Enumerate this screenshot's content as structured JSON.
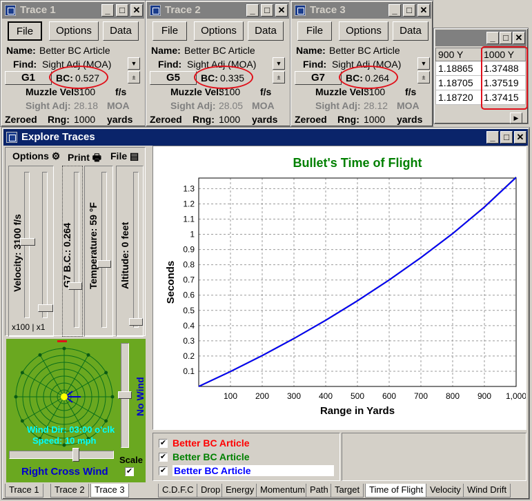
{
  "traces": [
    {
      "title": "Trace 1",
      "menu": [
        "File",
        "Options",
        "Data"
      ],
      "name_label": "Name:",
      "name": "Better BC Article",
      "find_label": "Find:",
      "find_value": "Sight Adj (MOA)",
      "model": "G1",
      "bc_label": "BC:",
      "bc": "0.527",
      "mv_label": "Muzzle Vel:",
      "mv": "3100",
      "mv_unit": "f/s",
      "sa_label": "Sight Adj:",
      "sa": "28.18",
      "sa_unit": "MOA",
      "zero_label": "Zeroed",
      "rng_label": "Rng:",
      "rng": "1000",
      "rng_unit": "yards"
    },
    {
      "title": "Trace 2",
      "menu": [
        "File",
        "Options",
        "Data"
      ],
      "name_label": "Name:",
      "name": "Better BC Article",
      "find_label": "Find:",
      "find_value": "Sight Adj (MOA)",
      "model": "G5",
      "bc_label": "BC:",
      "bc": "0.335",
      "mv_label": "Muzzle Vel:",
      "mv": "3100",
      "mv_unit": "f/s",
      "sa_label": "Sight Adj:",
      "sa": "28.05",
      "sa_unit": "MOA",
      "zero_label": "Zeroed",
      "rng_label": "Rng:",
      "rng": "1000",
      "rng_unit": "yards"
    },
    {
      "title": "Trace 3",
      "menu": [
        "File",
        "Options",
        "Data"
      ],
      "name_label": "Name:",
      "name": "Better BC Article",
      "find_label": "Find:",
      "find_value": "Sight Adj (MOA)",
      "model": "G7",
      "bc_label": "BC:",
      "bc": "0.264",
      "mv_label": "Muzzle Vel:",
      "mv": "3100",
      "mv_unit": "f/s",
      "sa_label": "Sight Adj:",
      "sa": "28.12",
      "sa_unit": "MOA",
      "zero_label": "Zeroed",
      "rng_label": "Rng:",
      "rng": "1000",
      "rng_unit": "yards"
    }
  ],
  "table": {
    "headers": [
      "900 Y",
      "1000 Y"
    ],
    "rows": [
      [
        "1.18865",
        "1.37488"
      ],
      [
        "1.18705",
        "1.37519"
      ],
      [
        "1.18720",
        "1.37415"
      ]
    ]
  },
  "explore": {
    "title": "Explore Traces",
    "options_label": "Options",
    "print_label": "Print",
    "file_label": "File",
    "velocity_label": "Velocity: 3100 f/s",
    "bc_slider_label": "G7 B.C.: 0.264",
    "temp_label": "Temperature: 59 °F",
    "alt_label": "Altitude: 0 feet",
    "scale_text": "x100 | x1",
    "wind_dir": "Wind Dir: 03:00 o'clk",
    "wind_speed": "Speed: 10 mph",
    "no_wind": "No Wind",
    "scale_label": "Scale",
    "cross_wind": "Right Cross Wind",
    "legend": [
      {
        "name": "Better BC Article",
        "color": "#ff0000"
      },
      {
        "name": "Better BC Article",
        "color": "#008000"
      },
      {
        "name": "Better BC Article",
        "color": "#0000ff"
      }
    ],
    "left_tabs": [
      "Trace 1",
      "Trace 2",
      "Trace 3"
    ],
    "tabs": [
      "C.D.F.C",
      "Drop",
      "Energy",
      "Momentum",
      "Path",
      "Target",
      "Time of Flight",
      "Velocity",
      "Wind Drift"
    ],
    "selected_tab": "Time of Flight"
  },
  "chart_data": {
    "type": "line",
    "title": "Bullet's Time of Flight",
    "xlabel": "Range in Yards",
    "ylabel": "Seconds",
    "xlim": [
      0,
      1000
    ],
    "ylim": [
      0,
      1.37
    ],
    "xticks": [
      "100",
      "200",
      "300",
      "400",
      "500",
      "600",
      "700",
      "800",
      "900",
      "1,000"
    ],
    "yticks": [
      "0.1",
      "0.2",
      "0.3",
      "0.4",
      "0.5",
      "0.6",
      "0.7",
      "0.8",
      "0.9",
      "1",
      "1.1",
      "1.2",
      "1.3"
    ],
    "x": [
      0,
      100,
      200,
      300,
      400,
      500,
      600,
      700,
      800,
      900,
      1000
    ],
    "series": [
      {
        "name": "Better BC Article",
        "color": "#ff0000",
        "values": [
          0,
          0.098,
          0.203,
          0.315,
          0.435,
          0.563,
          0.7,
          0.847,
          1.005,
          1.18,
          1.375
        ]
      },
      {
        "name": "Better BC Article",
        "color": "#008000",
        "values": [
          0,
          0.098,
          0.203,
          0.315,
          0.435,
          0.563,
          0.7,
          0.847,
          1.005,
          1.179,
          1.375
        ]
      },
      {
        "name": "Better BC Article",
        "color": "#0000ff",
        "values": [
          0,
          0.098,
          0.203,
          0.315,
          0.435,
          0.563,
          0.7,
          0.847,
          1.005,
          1.179,
          1.374
        ]
      }
    ],
    "grid": true
  }
}
